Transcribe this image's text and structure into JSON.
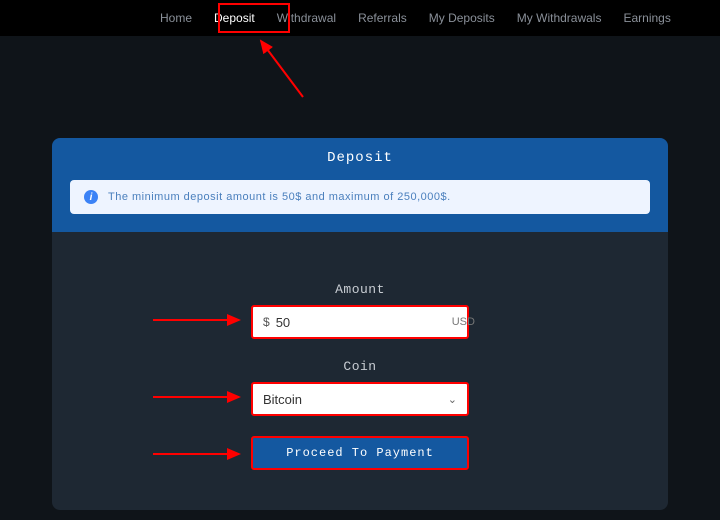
{
  "nav": {
    "items": [
      "Home",
      "Deposit",
      "Withdrawal",
      "Referrals",
      "My Deposits",
      "My Withdrawals",
      "Earnings"
    ],
    "active_index": 1
  },
  "card": {
    "title": "Deposit",
    "info": "The minimum deposit amount is 50$ and maximum of 250,000$.",
    "amount_label": "Amount",
    "amount_prefix": "$",
    "amount_value": "50",
    "amount_suffix": "USD",
    "coin_label": "Coin",
    "coin_value": "Bitcoin",
    "button_label": "Proceed To Payment"
  },
  "annotations": {
    "highlight_color": "#ff0000"
  }
}
